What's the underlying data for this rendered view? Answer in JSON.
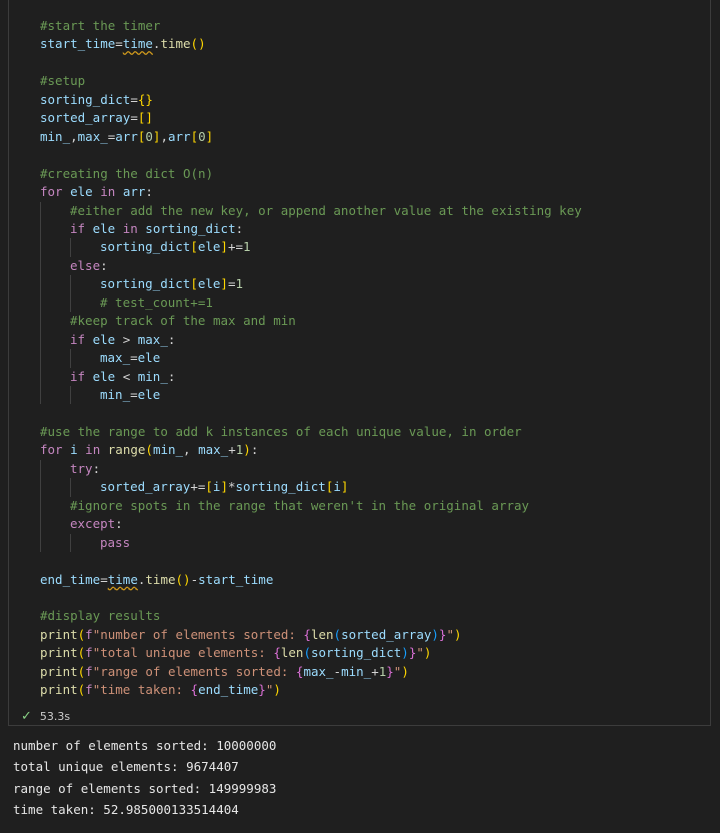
{
  "code_lines": [
    {
      "indent": 0,
      "tokens": [
        {
          "t": "#start the timer",
          "c": "cm"
        }
      ]
    },
    {
      "indent": 0,
      "tokens": [
        {
          "t": "start_time",
          "c": "var"
        },
        {
          "t": "=",
          "c": "op"
        },
        {
          "t": "time",
          "c": "err"
        },
        {
          "t": ".",
          "c": "op"
        },
        {
          "t": "time",
          "c": "fn"
        },
        {
          "t": "()",
          "c": "br1"
        }
      ]
    },
    {
      "indent": 0,
      "tokens": []
    },
    {
      "indent": 0,
      "tokens": [
        {
          "t": "#setup",
          "c": "cm"
        }
      ]
    },
    {
      "indent": 0,
      "tokens": [
        {
          "t": "sorting_dict",
          "c": "var"
        },
        {
          "t": "=",
          "c": "op"
        },
        {
          "t": "{}",
          "c": "br1"
        }
      ]
    },
    {
      "indent": 0,
      "tokens": [
        {
          "t": "sorted_array",
          "c": "var"
        },
        {
          "t": "=",
          "c": "op"
        },
        {
          "t": "[]",
          "c": "br1"
        }
      ]
    },
    {
      "indent": 0,
      "tokens": [
        {
          "t": "min_",
          "c": "var"
        },
        {
          "t": ",",
          "c": "op"
        },
        {
          "t": "max_",
          "c": "var"
        },
        {
          "t": "=",
          "c": "op"
        },
        {
          "t": "arr",
          "c": "var"
        },
        {
          "t": "[",
          "c": "br1"
        },
        {
          "t": "0",
          "c": "num"
        },
        {
          "t": "]",
          "c": "br1"
        },
        {
          "t": ",",
          "c": "op"
        },
        {
          "t": "arr",
          "c": "var"
        },
        {
          "t": "[",
          "c": "br1"
        },
        {
          "t": "0",
          "c": "num"
        },
        {
          "t": "]",
          "c": "br1"
        }
      ]
    },
    {
      "indent": 0,
      "tokens": []
    },
    {
      "indent": 0,
      "tokens": [
        {
          "t": "#creating the dict O(n)",
          "c": "cm"
        }
      ]
    },
    {
      "indent": 0,
      "tokens": [
        {
          "t": "for",
          "c": "kw"
        },
        {
          "t": " ",
          "c": "pl"
        },
        {
          "t": "ele",
          "c": "var"
        },
        {
          "t": " ",
          "c": "pl"
        },
        {
          "t": "in",
          "c": "kw"
        },
        {
          "t": " ",
          "c": "pl"
        },
        {
          "t": "arr",
          "c": "var"
        },
        {
          "t": ":",
          "c": "op"
        }
      ]
    },
    {
      "indent": 1,
      "tokens": [
        {
          "t": "#either add the new key, or append another value at the existing key",
          "c": "cm"
        }
      ]
    },
    {
      "indent": 1,
      "tokens": [
        {
          "t": "if",
          "c": "kw"
        },
        {
          "t": " ",
          "c": "pl"
        },
        {
          "t": "ele",
          "c": "var"
        },
        {
          "t": " ",
          "c": "pl"
        },
        {
          "t": "in",
          "c": "kw"
        },
        {
          "t": " ",
          "c": "pl"
        },
        {
          "t": "sorting_dict",
          "c": "var"
        },
        {
          "t": ":",
          "c": "op"
        }
      ]
    },
    {
      "indent": 2,
      "tokens": [
        {
          "t": "sorting_dict",
          "c": "var"
        },
        {
          "t": "[",
          "c": "br1"
        },
        {
          "t": "ele",
          "c": "var"
        },
        {
          "t": "]",
          "c": "br1"
        },
        {
          "t": "+=",
          "c": "op"
        },
        {
          "t": "1",
          "c": "num"
        }
      ]
    },
    {
      "indent": 1,
      "tokens": [
        {
          "t": "else",
          "c": "kw"
        },
        {
          "t": ":",
          "c": "op"
        }
      ]
    },
    {
      "indent": 2,
      "tokens": [
        {
          "t": "sorting_dict",
          "c": "var"
        },
        {
          "t": "[",
          "c": "br1"
        },
        {
          "t": "ele",
          "c": "var"
        },
        {
          "t": "]",
          "c": "br1"
        },
        {
          "t": "=",
          "c": "op"
        },
        {
          "t": "1",
          "c": "num"
        }
      ]
    },
    {
      "indent": 2,
      "tokens": [
        {
          "t": "# test_count+=1",
          "c": "cm"
        }
      ]
    },
    {
      "indent": 1,
      "tokens": [
        {
          "t": "#keep track of the max and min",
          "c": "cm"
        }
      ]
    },
    {
      "indent": 1,
      "tokens": [
        {
          "t": "if",
          "c": "kw"
        },
        {
          "t": " ",
          "c": "pl"
        },
        {
          "t": "ele",
          "c": "var"
        },
        {
          "t": " > ",
          "c": "op"
        },
        {
          "t": "max_",
          "c": "var"
        },
        {
          "t": ":",
          "c": "op"
        }
      ]
    },
    {
      "indent": 2,
      "tokens": [
        {
          "t": "max_",
          "c": "var"
        },
        {
          "t": "=",
          "c": "op"
        },
        {
          "t": "ele",
          "c": "var"
        }
      ]
    },
    {
      "indent": 1,
      "tokens": [
        {
          "t": "if",
          "c": "kw"
        },
        {
          "t": " ",
          "c": "pl"
        },
        {
          "t": "ele",
          "c": "var"
        },
        {
          "t": " < ",
          "c": "op"
        },
        {
          "t": "min_",
          "c": "var"
        },
        {
          "t": ":",
          "c": "op"
        }
      ]
    },
    {
      "indent": 2,
      "tokens": [
        {
          "t": "min_",
          "c": "var"
        },
        {
          "t": "=",
          "c": "op"
        },
        {
          "t": "ele",
          "c": "var"
        }
      ]
    },
    {
      "indent": 0,
      "tokens": []
    },
    {
      "indent": 0,
      "tokens": [
        {
          "t": "#use the range to add k instances of each unique value, in order",
          "c": "cm"
        }
      ]
    },
    {
      "indent": 0,
      "tokens": [
        {
          "t": "for",
          "c": "kw"
        },
        {
          "t": " ",
          "c": "pl"
        },
        {
          "t": "i",
          "c": "var"
        },
        {
          "t": " ",
          "c": "pl"
        },
        {
          "t": "in",
          "c": "kw"
        },
        {
          "t": " ",
          "c": "pl"
        },
        {
          "t": "range",
          "c": "fn"
        },
        {
          "t": "(",
          "c": "br1"
        },
        {
          "t": "min_",
          "c": "var"
        },
        {
          "t": ", ",
          "c": "op"
        },
        {
          "t": "max_",
          "c": "var"
        },
        {
          "t": "+",
          "c": "op"
        },
        {
          "t": "1",
          "c": "num"
        },
        {
          "t": ")",
          "c": "br1"
        },
        {
          "t": ":",
          "c": "op"
        }
      ]
    },
    {
      "indent": 1,
      "tokens": [
        {
          "t": "try",
          "c": "kw"
        },
        {
          "t": ":",
          "c": "op"
        }
      ]
    },
    {
      "indent": 2,
      "tokens": [
        {
          "t": "sorted_array",
          "c": "var"
        },
        {
          "t": "+=",
          "c": "op"
        },
        {
          "t": "[",
          "c": "br1"
        },
        {
          "t": "i",
          "c": "var"
        },
        {
          "t": "]",
          "c": "br1"
        },
        {
          "t": "*",
          "c": "op"
        },
        {
          "t": "sorting_dict",
          "c": "var"
        },
        {
          "t": "[",
          "c": "br1"
        },
        {
          "t": "i",
          "c": "var"
        },
        {
          "t": "]",
          "c": "br1"
        }
      ]
    },
    {
      "indent": 1,
      "tokens": [
        {
          "t": "#ignore spots in the range that weren't in the original array",
          "c": "cm"
        }
      ]
    },
    {
      "indent": 1,
      "tokens": [
        {
          "t": "except",
          "c": "kw"
        },
        {
          "t": ":",
          "c": "op"
        }
      ]
    },
    {
      "indent": 2,
      "tokens": [
        {
          "t": "pass",
          "c": "kw"
        }
      ]
    },
    {
      "indent": 0,
      "tokens": []
    },
    {
      "indent": 0,
      "tokens": [
        {
          "t": "end_time",
          "c": "var"
        },
        {
          "t": "=",
          "c": "op"
        },
        {
          "t": "time",
          "c": "err"
        },
        {
          "t": ".",
          "c": "op"
        },
        {
          "t": "time",
          "c": "fn"
        },
        {
          "t": "()",
          "c": "br1"
        },
        {
          "t": "-",
          "c": "op"
        },
        {
          "t": "start_time",
          "c": "var"
        }
      ]
    },
    {
      "indent": 0,
      "tokens": []
    },
    {
      "indent": 0,
      "tokens": [
        {
          "t": "#display results",
          "c": "cm"
        }
      ]
    },
    {
      "indent": 0,
      "tokens": [
        {
          "t": "print",
          "c": "fn"
        },
        {
          "t": "(",
          "c": "br1"
        },
        {
          "t": "f",
          "c": "kw"
        },
        {
          "t": "\"number of elements sorted: ",
          "c": "str"
        },
        {
          "t": "{",
          "c": "br2"
        },
        {
          "t": "len",
          "c": "fn"
        },
        {
          "t": "(",
          "c": "br3"
        },
        {
          "t": "sorted_array",
          "c": "var"
        },
        {
          "t": ")",
          "c": "br3"
        },
        {
          "t": "}",
          "c": "br2"
        },
        {
          "t": "\"",
          "c": "str"
        },
        {
          "t": ")",
          "c": "br1"
        }
      ]
    },
    {
      "indent": 0,
      "tokens": [
        {
          "t": "print",
          "c": "fn"
        },
        {
          "t": "(",
          "c": "br1"
        },
        {
          "t": "f",
          "c": "kw"
        },
        {
          "t": "\"total unique elements: ",
          "c": "str"
        },
        {
          "t": "{",
          "c": "br2"
        },
        {
          "t": "len",
          "c": "fn"
        },
        {
          "t": "(",
          "c": "br3"
        },
        {
          "t": "sorting_dict",
          "c": "var"
        },
        {
          "t": ")",
          "c": "br3"
        },
        {
          "t": "}",
          "c": "br2"
        },
        {
          "t": "\"",
          "c": "str"
        },
        {
          "t": ")",
          "c": "br1"
        }
      ]
    },
    {
      "indent": 0,
      "tokens": [
        {
          "t": "print",
          "c": "fn"
        },
        {
          "t": "(",
          "c": "br1"
        },
        {
          "t": "f",
          "c": "kw"
        },
        {
          "t": "\"range of elements sorted: ",
          "c": "str"
        },
        {
          "t": "{",
          "c": "br2"
        },
        {
          "t": "max_",
          "c": "var"
        },
        {
          "t": "-",
          "c": "op"
        },
        {
          "t": "min_",
          "c": "var"
        },
        {
          "t": "+",
          "c": "op"
        },
        {
          "t": "1",
          "c": "num"
        },
        {
          "t": "}",
          "c": "br2"
        },
        {
          "t": "\"",
          "c": "str"
        },
        {
          "t": ")",
          "c": "br1"
        }
      ]
    },
    {
      "indent": 0,
      "tokens": [
        {
          "t": "print",
          "c": "fn"
        },
        {
          "t": "(",
          "c": "br1"
        },
        {
          "t": "f",
          "c": "kw"
        },
        {
          "t": "\"time taken: ",
          "c": "str"
        },
        {
          "t": "{",
          "c": "br2"
        },
        {
          "t": "end_time",
          "c": "var"
        },
        {
          "t": "}",
          "c": "br2"
        },
        {
          "t": "\"",
          "c": "str"
        },
        {
          "t": ")",
          "c": "br1"
        }
      ]
    }
  ],
  "execution": {
    "status_icon": "check-icon",
    "duration": "53.3s"
  },
  "output_lines": [
    "number of elements sorted: 10000000",
    "total unique elements: 9674407",
    "range of elements sorted: 149999983",
    "time taken: 52.985000133514404"
  ],
  "colors": {
    "background": "#1f1f1f",
    "comment": "#6a9955",
    "keyword": "#c586c0",
    "variable": "#9cdcfe",
    "function": "#dcdcaa",
    "number": "#b5cea8",
    "string": "#ce9178",
    "bracket_level1": "#ffd700",
    "bracket_level2": "#da70d6",
    "bracket_level3": "#179fff",
    "success": "#89d185"
  }
}
